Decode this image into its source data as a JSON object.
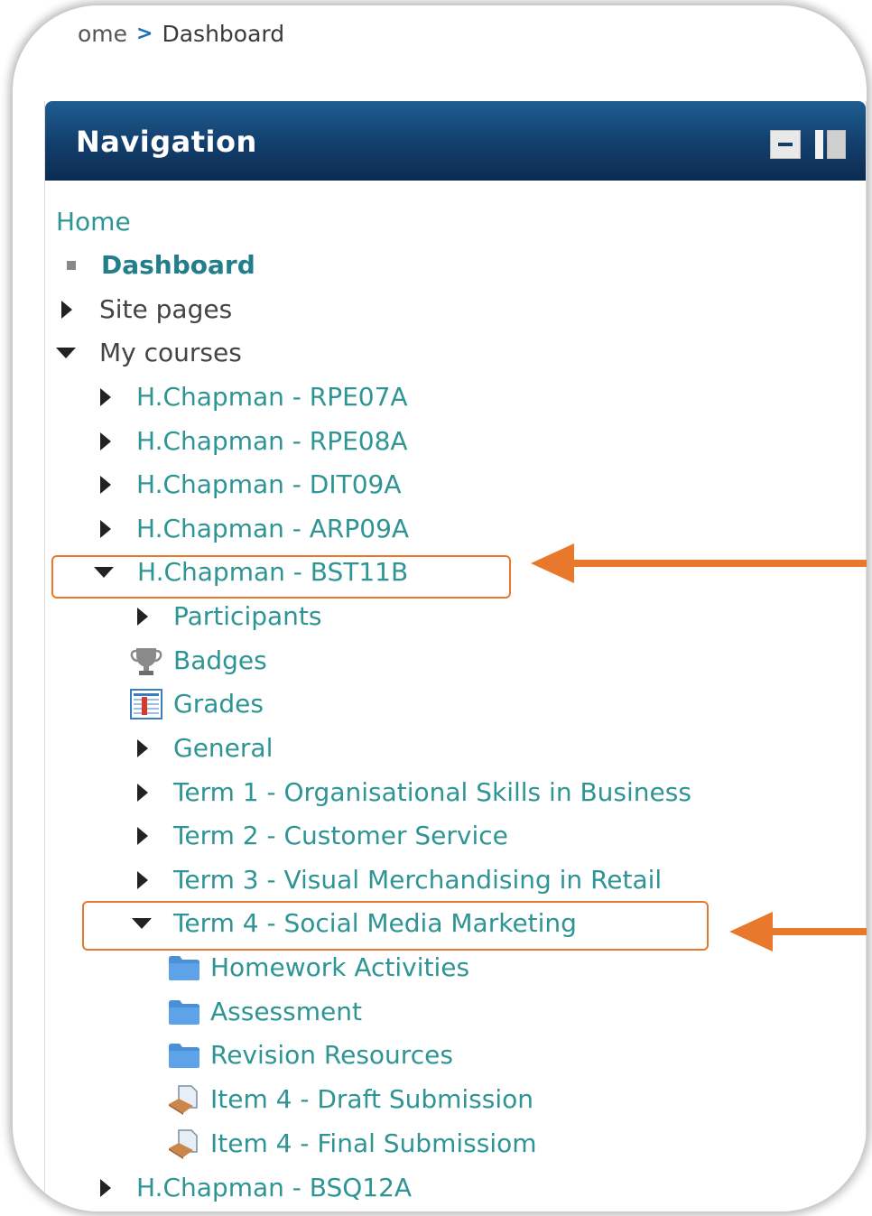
{
  "breadcrumb": {
    "home": "ome",
    "separator": ">",
    "current": "Dashboard"
  },
  "block": {
    "title": "Navigation",
    "collapse_icon": "minus-icon",
    "dock_icon": "dock-icon",
    "header_color": "#123e6b"
  },
  "accent": {
    "link": "#2e9494",
    "highlight": "#e8782b"
  },
  "nav": {
    "home": "Home",
    "dashboard": "Dashboard",
    "site_pages": "Site pages",
    "my_courses": "My courses",
    "courses": [
      "H.Chapman - RPE07A",
      "H.Chapman - RPE08A",
      "H.Chapman - DIT09A",
      "H.Chapman - ARP09A"
    ],
    "expanded_course": "H.Chapman - BST11B",
    "course_items": {
      "participants": "Participants",
      "badges": "Badges",
      "grades": "Grades",
      "general": "General",
      "term1": "Term 1 - Organisational Skills in Business",
      "term2": "Term 2 - Customer Service",
      "term3": "Term 3 - Visual Merchandising in Retail",
      "term4": "Term 4 - Social Media Marketing"
    },
    "term4_items": {
      "homework": "Homework Activities",
      "assessment": "Assessment",
      "revision": "Revision Resources",
      "draft": "Item 4 - Draft Submission",
      "final": "Item 4 - Final Submissiom"
    },
    "last_course": "H.Chapman - BSQ12A"
  }
}
